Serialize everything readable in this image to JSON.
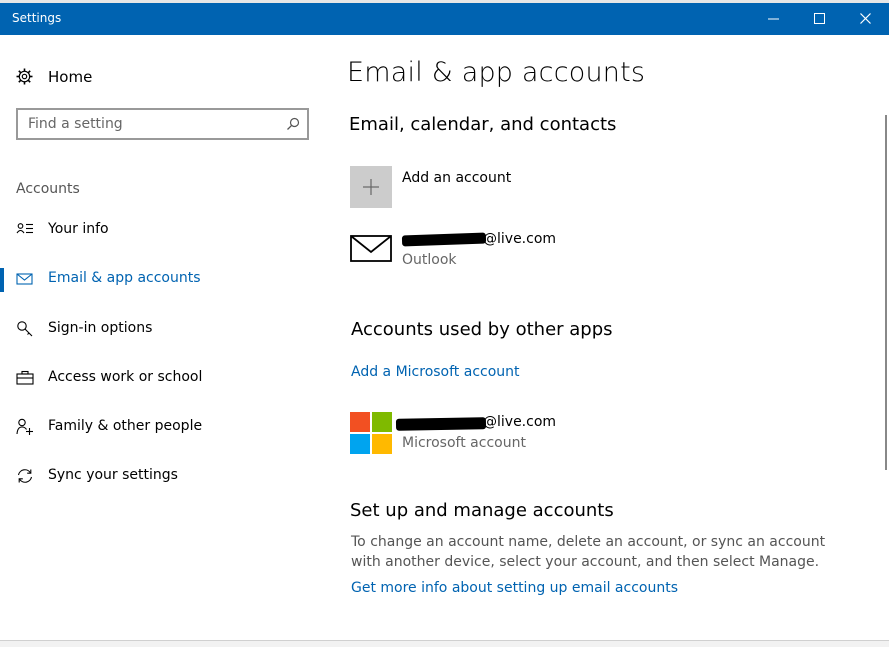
{
  "window": {
    "title": "Settings"
  },
  "sidebar": {
    "home_label": "Home",
    "search_placeholder": "Find a setting",
    "section_heading": "Accounts",
    "items": [
      {
        "label": "Your info",
        "icon": "person-list-icon",
        "active": false
      },
      {
        "label": "Email & app accounts",
        "icon": "mail-icon",
        "active": true
      },
      {
        "label": "Sign-in options",
        "icon": "key-icon",
        "active": false
      },
      {
        "label": "Access work or school",
        "icon": "briefcase-icon",
        "active": false
      },
      {
        "label": "Family & other people",
        "icon": "add-person-icon",
        "active": false
      },
      {
        "label": "Sync your settings",
        "icon": "sync-icon",
        "active": false
      }
    ]
  },
  "main": {
    "page_title": "Email & app accounts",
    "email_section": {
      "heading": "Email, calendar, and contacts",
      "add_account_label": "Add an account",
      "account": {
        "email_suffix": "@live.com",
        "provider": "Outlook"
      }
    },
    "other_apps_section": {
      "heading": "Accounts used by other apps",
      "add_ms_link": "Add a Microsoft account",
      "account": {
        "email_suffix": "@live.com",
        "type": "Microsoft account"
      }
    },
    "manage_section": {
      "heading": "Set up and manage accounts",
      "description": "To change an account name, delete an account, or sync an account with another device, select your account, and then select Manage.",
      "more_info_link": "Get more info about setting up email accounts"
    }
  },
  "colors": {
    "accent": "#0063b1",
    "ms_red": "#f25022",
    "ms_green": "#7fba00",
    "ms_blue": "#00a4ef",
    "ms_yellow": "#ffb900"
  }
}
